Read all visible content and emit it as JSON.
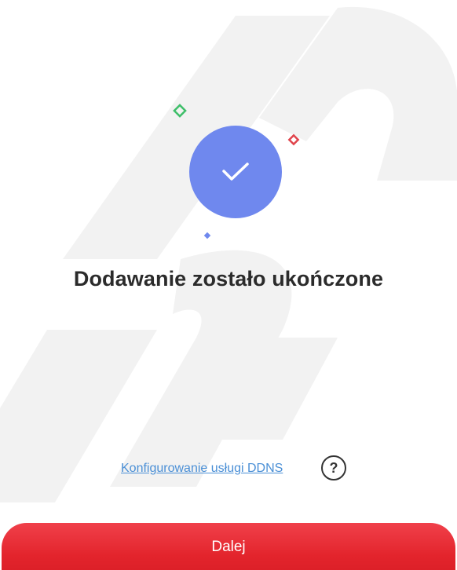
{
  "title": "Dodawanie zostało ukończone",
  "ddns": {
    "link_label": "Konfigurowanie usługi DDNS",
    "help_glyph": "?"
  },
  "next_button": {
    "label": "Dalej"
  },
  "icons": {
    "success": "checkmark-icon",
    "help": "question-mark-icon"
  },
  "colors": {
    "accent": "#e3242c",
    "success_circle": "#6f88ee",
    "link": "#4a8fd6",
    "title": "#2b2b2b",
    "sparkle_green": "#3fbf6a",
    "sparkle_red": "#e0444c",
    "sparkle_blue": "#6f88ee"
  }
}
